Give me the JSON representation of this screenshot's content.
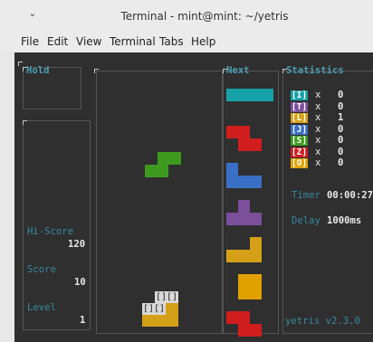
{
  "window": {
    "title": "Terminal - mint@mint: ~/yetris",
    "menu_icon": "chevron-down-icon"
  },
  "menubar": [
    {
      "id": "file",
      "label": "File"
    },
    {
      "id": "edit",
      "label": "Edit"
    },
    {
      "id": "view",
      "label": "View"
    },
    {
      "id": "terminal",
      "label": "Terminal"
    },
    {
      "id": "tabs",
      "label": "Tabs"
    },
    {
      "id": "help",
      "label": "Help"
    }
  ],
  "game": {
    "hold_label": "Hold",
    "next_label": "Next",
    "statistics_label": "Statistics",
    "hiscore_label": "Hi-Score",
    "hiscore_value": "120",
    "score_label": "Score",
    "score_value": "10",
    "level_label": "Level",
    "level_value": "1",
    "stats": [
      {
        "piece": "[I]",
        "sep": "x",
        "count": "0",
        "color": "#17a1a8"
      },
      {
        "piece": "[T]",
        "sep": "x",
        "count": "0",
        "color": "#7b4f9a"
      },
      {
        "piece": "[L]",
        "sep": "x",
        "count": "1",
        "color": "#d4a018"
      },
      {
        "piece": "[J]",
        "sep": "x",
        "count": "0",
        "color": "#3a6fc6"
      },
      {
        "piece": "[S]",
        "sep": "x",
        "count": "0",
        "color": "#3e9a1e"
      },
      {
        "piece": "[Z]",
        "sep": "x",
        "count": "0",
        "color": "#d01e1e"
      },
      {
        "piece": "[O]",
        "sep": "x",
        "count": "0",
        "color": "#e0a000"
      }
    ],
    "timer_label": "Timer",
    "timer_value": "00:00:27",
    "delay_label": "Delay",
    "delay_value": "1000ms",
    "version": "yetris v2.3.0",
    "ghost_text": "[][]",
    "next_queue": [
      "I",
      "Z",
      "J",
      "T",
      "L",
      "O",
      "Z"
    ],
    "colors": {
      "I": "#17a1a8",
      "Z": "#d01e1e",
      "J": "#3a6fc6",
      "T": "#7b4f9a",
      "L": "#d4a018",
      "O": "#e0a000",
      "S": "#3e9a1e"
    }
  }
}
